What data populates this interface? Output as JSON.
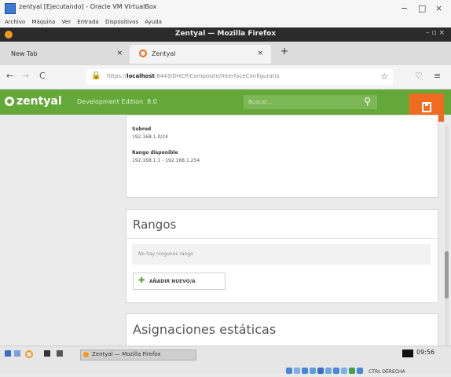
{
  "vbox": {
    "title": "zentyal [Ejecutando] - Oracle VM VirtualBox",
    "menu": [
      "Archivo",
      "Máquina",
      "Ver",
      "Entrada",
      "Dispositivos",
      "Ayuda"
    ],
    "minimize": "−",
    "maximize": "□",
    "close": "×"
  },
  "firefox": {
    "title": "Zentyal — Mozilla Firefox",
    "tabs": [
      {
        "label": "New Tab",
        "close": "×"
      },
      {
        "label": "Zentyal",
        "close": "×"
      }
    ],
    "new_tab": "+",
    "url_prefix": "https://",
    "url_host": "localhost",
    "url_path": ":8443/DHCP/Composite/InterfaceConfiguratio",
    "back": "←",
    "forward": "→",
    "reload": "C"
  },
  "zentyal": {
    "logo": "zentyal",
    "edition": "Development Edition",
    "version": "8.0",
    "search_placeholder": "Buscar...",
    "subred_label": "Subred",
    "subred_value": "192.168.1.0/24",
    "rango_label": "Rango disponible",
    "rango_value": "192.168.1.1 - 192.168.1.254",
    "rangos_title": "Rangos",
    "rangos_empty": "No hay ningunos rango",
    "add_new": "AÑADIR NUEVO/A",
    "asignaciones_title": "Asignaciones estáticas"
  },
  "taskbar": {
    "window": "Zentyal — Mozilla Firefox",
    "time": "09:56",
    "ctrl": "CTRL DERECHA"
  },
  "colors": {
    "zentyal_green": "#64a83a",
    "save_orange": "#f06a1f"
  }
}
